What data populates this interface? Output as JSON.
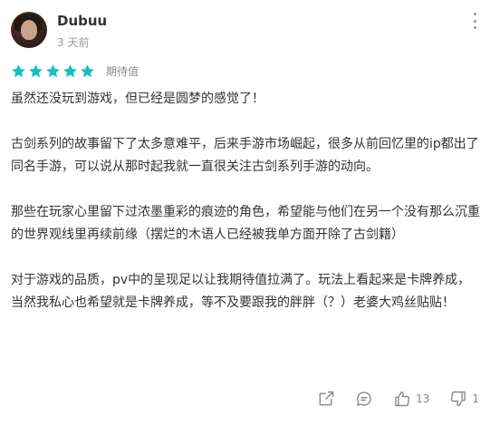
{
  "user": {
    "name": "Dubuu",
    "time": "3 天前"
  },
  "rating": {
    "stars": 5,
    "label": "期待值",
    "color": "#14c1c1"
  },
  "review": {
    "paragraphs": [
      "虽然还没玩到游戏，但已经是圆梦的感觉了！",
      "古剑系列的故事留下了太多意难平，后来手游市场崛起，很多从前回忆里的ip都出了同名手游，可以说从那时起我就一直很关注古剑系列手游的动向。",
      "那些在玩家心里留下过浓墨重彩的痕迹的角色，希望能与他们在另一个没有那么沉重的世界观线里再续前缘（摆烂的木语人已经被我单方面开除了古剑籍）",
      "对于游戏的品质，pv中的呈现足以让我期待值拉满了。玩法上看起来是卡牌养成，当然我私心也希望就是卡牌养成，等不及要跟我的胖胖（？）老婆大鸡丝贴贴！"
    ]
  },
  "actions": {
    "share_icon": "share-icon",
    "comment_icon": "comment-icon",
    "like_icon": "thumbs-up-icon",
    "like_count": "13",
    "dislike_icon": "thumbs-down-icon",
    "dislike_count": "1"
  }
}
